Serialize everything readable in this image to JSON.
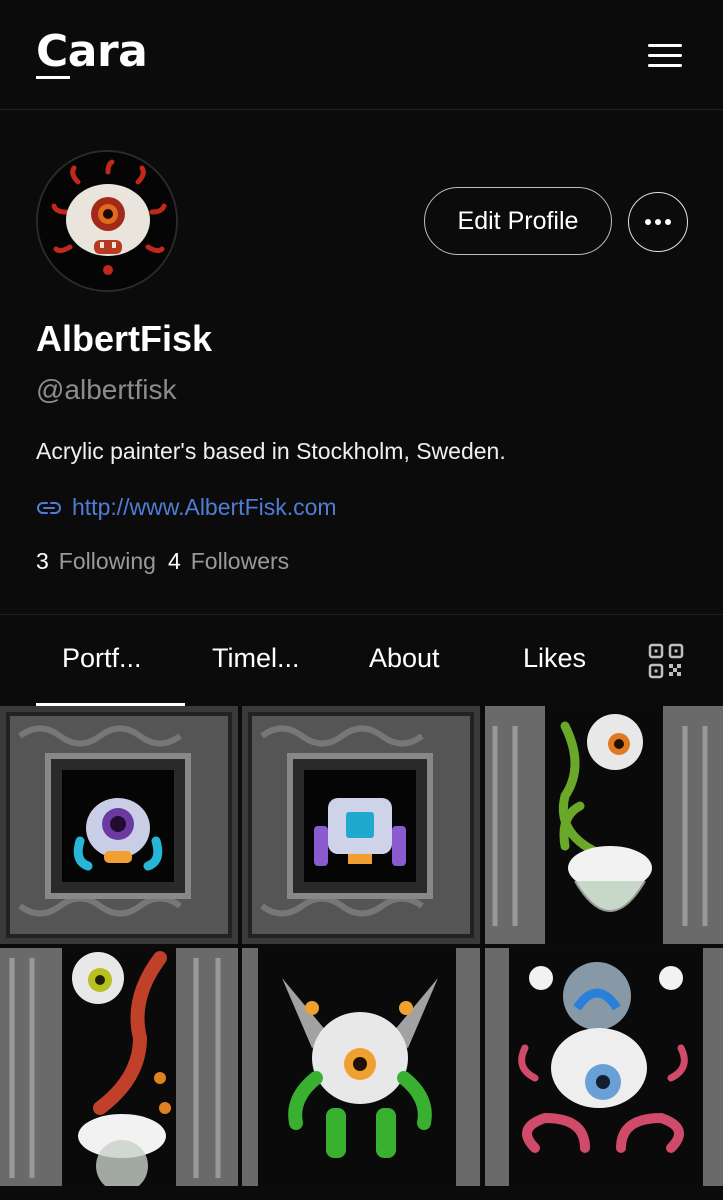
{
  "header": {
    "logo": "Cara",
    "menu_icon": "hamburger-menu-icon"
  },
  "profile": {
    "display_name": "AlbertFisk",
    "handle": "@albertfisk",
    "bio": "Acrylic painter's based in Stockholm, Sweden.",
    "link": "http://www.AlbertFisk.com",
    "link_icon": "link-icon",
    "edit_button": "Edit Profile",
    "more_icon": "more-dots-icon",
    "following_count": "3",
    "following_label": "Following",
    "followers_count": "4",
    "followers_label": "Followers"
  },
  "tabs": {
    "items": [
      {
        "label": "Portf...",
        "active": true
      },
      {
        "label": "Timel..."
      },
      {
        "label": "About"
      },
      {
        "label": "Likes"
      }
    ],
    "qr_icon": "qr-code-icon"
  },
  "colors": {
    "background": "#0b0b0b",
    "link": "#4f7dd6",
    "muted": "#8c8c8c"
  }
}
